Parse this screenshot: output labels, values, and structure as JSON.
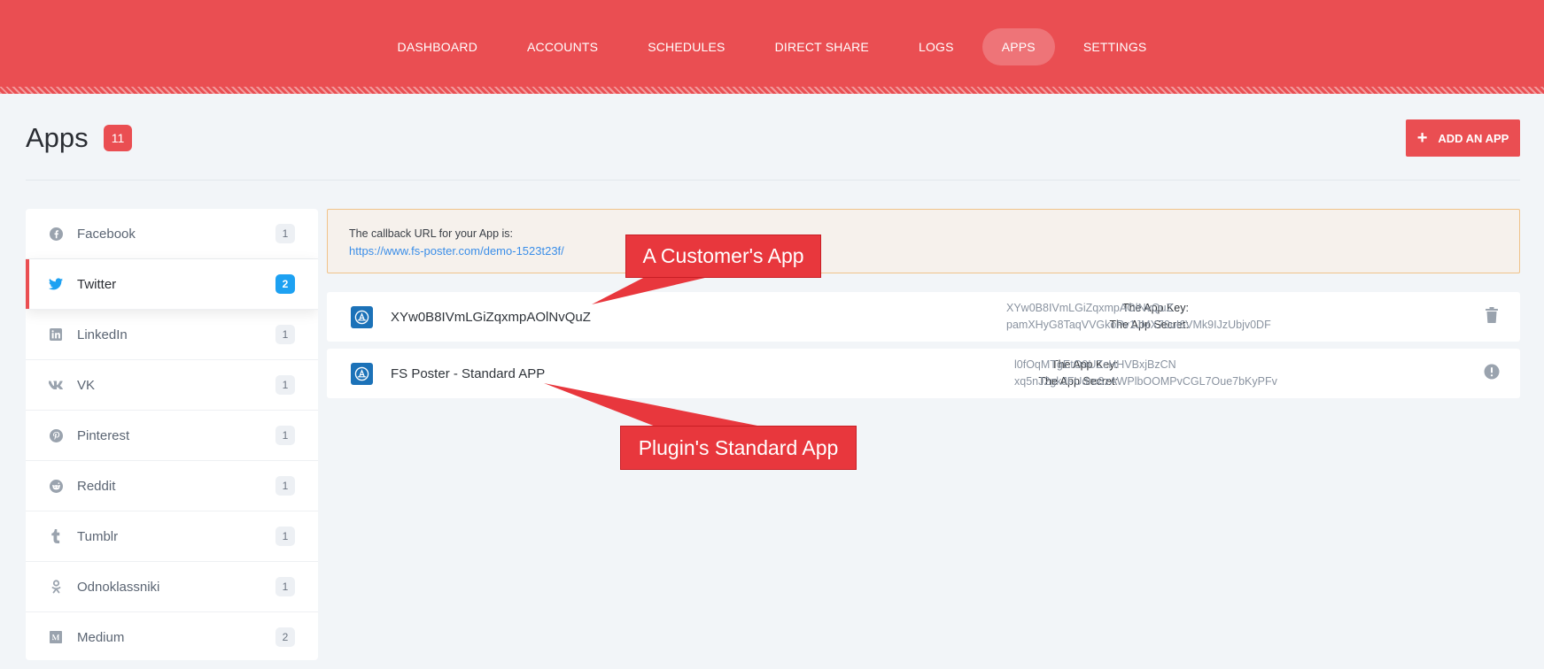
{
  "nav": {
    "items": [
      {
        "label": "DASHBOARD"
      },
      {
        "label": "ACCOUNTS"
      },
      {
        "label": "SCHEDULES"
      },
      {
        "label": "DIRECT SHARE"
      },
      {
        "label": "LOGS"
      },
      {
        "label": "APPS",
        "active": true
      },
      {
        "label": "SETTINGS"
      }
    ]
  },
  "header": {
    "title": "Apps",
    "count": "11",
    "add_button_label": "ADD AN APP"
  },
  "sidebar": {
    "items": [
      {
        "label": "Facebook",
        "count": "1",
        "icon": "facebook-icon"
      },
      {
        "label": "Twitter",
        "count": "2",
        "icon": "twitter-icon",
        "active": true
      },
      {
        "label": "LinkedIn",
        "count": "1",
        "icon": "linkedin-icon"
      },
      {
        "label": "VK",
        "count": "1",
        "icon": "vk-icon"
      },
      {
        "label": "Pinterest",
        "count": "1",
        "icon": "pinterest-icon"
      },
      {
        "label": "Reddit",
        "count": "1",
        "icon": "reddit-icon"
      },
      {
        "label": "Tumblr",
        "count": "1",
        "icon": "tumblr-icon"
      },
      {
        "label": "Odnoklassniki",
        "count": "1",
        "icon": "odnoklassniki-icon"
      },
      {
        "label": "Medium",
        "count": "2",
        "icon": "medium-icon"
      }
    ]
  },
  "callback": {
    "text": "The callback URL for your App is:",
    "url": "https://www.fs-poster.com/demo-1523t23f/"
  },
  "apps": [
    {
      "name": "XYw0B8IVmLGiZqxmpAOlNvQuZ",
      "key_label": "The App Key:",
      "key": "XYw0B8IVmLGiZqxmpAOlNvQuZ",
      "secret_label": "The App Secret:",
      "secret": "pamXHyG8TaqVVGkoPv1JMX70uI6VMk9IJzUbjv0DF",
      "action_icon": "trash-icon"
    },
    {
      "name": "FS Poster - Standard APP",
      "key_label": "The App Key:",
      "key": "l0fOqMTgEtO9UZcHHVBxjBzCN",
      "secret_label": "The App Secret:",
      "secret": "xq5nJ2gkJFUdro8zAWPlbOOMPvCGL7Oue7bKyPFv",
      "action_icon": "info-icon"
    }
  ],
  "annotations": {
    "customer_app": "A Customer's App",
    "standard_app": "Plugin's Standard App"
  },
  "colors": {
    "brand": "#ea4e52",
    "twitter": "#1da1f2",
    "link": "#3b8ee8"
  }
}
